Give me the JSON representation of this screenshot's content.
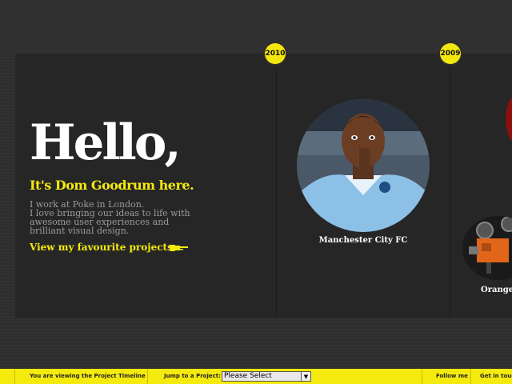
{
  "intro": {
    "greeting": "Hello,",
    "subtitle": "It's Dom Goodrum here.",
    "lines": [
      "I work at Poke in London.",
      "I love bringing our ideas to life with",
      "awesome user experiences and",
      "brilliant visual design."
    ],
    "link": "View my favourite projects"
  },
  "timeline": [
    {
      "year": "2010",
      "project": "Manchester City FC"
    },
    {
      "year": "2009",
      "project": "Orange"
    }
  ],
  "footer": {
    "viewing": "You are viewing the Project Timeline",
    "jump_label": "Jump to a Project:",
    "select_value": "Please Select",
    "follow": "Follow me",
    "contact": "Get in touch"
  },
  "colors": {
    "accent": "#f5ea0e",
    "panel": "#262626",
    "background": "#2e2e2e"
  },
  "icons": [
    "hand-pointer-icon",
    "chevron-down-icon",
    "projector-icon"
  ]
}
